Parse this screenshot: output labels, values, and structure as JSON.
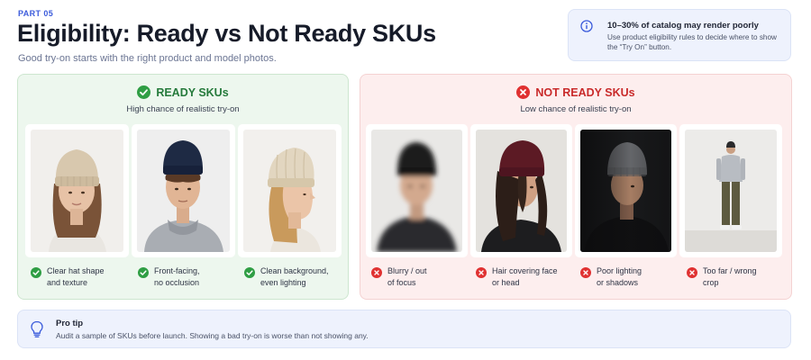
{
  "header": {
    "part": "PART 05",
    "title": "Eligibility: Ready vs Not Ready SKUs",
    "subtitle": "Good try-on starts with the right product and model photos."
  },
  "callout": {
    "icon": "info-icon",
    "title": "10–30% of catalog may render poorly",
    "body": "Use product eligibility rules to decide where to show the “Try On” button."
  },
  "ready": {
    "icon": "check-circle-icon",
    "title": "READY SKUs",
    "subtitle": "High chance of realistic try-on",
    "color": "#2f9e44",
    "items": [
      {
        "line1": "Clear hat shape",
        "line2": "and texture",
        "photo": "woman-cream-beanie-front"
      },
      {
        "line1": "Front-facing,",
        "line2": "no occlusion",
        "photo": "man-navy-beanie-gray-hoodie"
      },
      {
        "line1": "Clean background,",
        "line2": "even lighting",
        "photo": "woman-cream-beanie-profile"
      }
    ]
  },
  "not_ready": {
    "icon": "x-circle-icon",
    "title": "NOT READY SKUs",
    "subtitle": "Low chance of realistic try-on",
    "color": "#e03131",
    "items": [
      {
        "line1": "Blurry / out",
        "line2": "of focus",
        "photo": "blurry-man-black-beanie"
      },
      {
        "line1": "Hair covering face",
        "line2": "or head",
        "photo": "hair-covering-face-maroon-beanie"
      },
      {
        "line1": "Poor lighting",
        "line2": "or shadows",
        "photo": "dark-lit-man-gray-beanie"
      },
      {
        "line1": "Too far / wrong",
        "line2": "crop",
        "photo": "full-body-man-far-away"
      }
    ]
  },
  "tip": {
    "icon": "lightbulb-icon",
    "title": "Pro tip",
    "body": "Audit a sample of SKUs before launch. Showing a bad try-on is worse than not showing any."
  }
}
